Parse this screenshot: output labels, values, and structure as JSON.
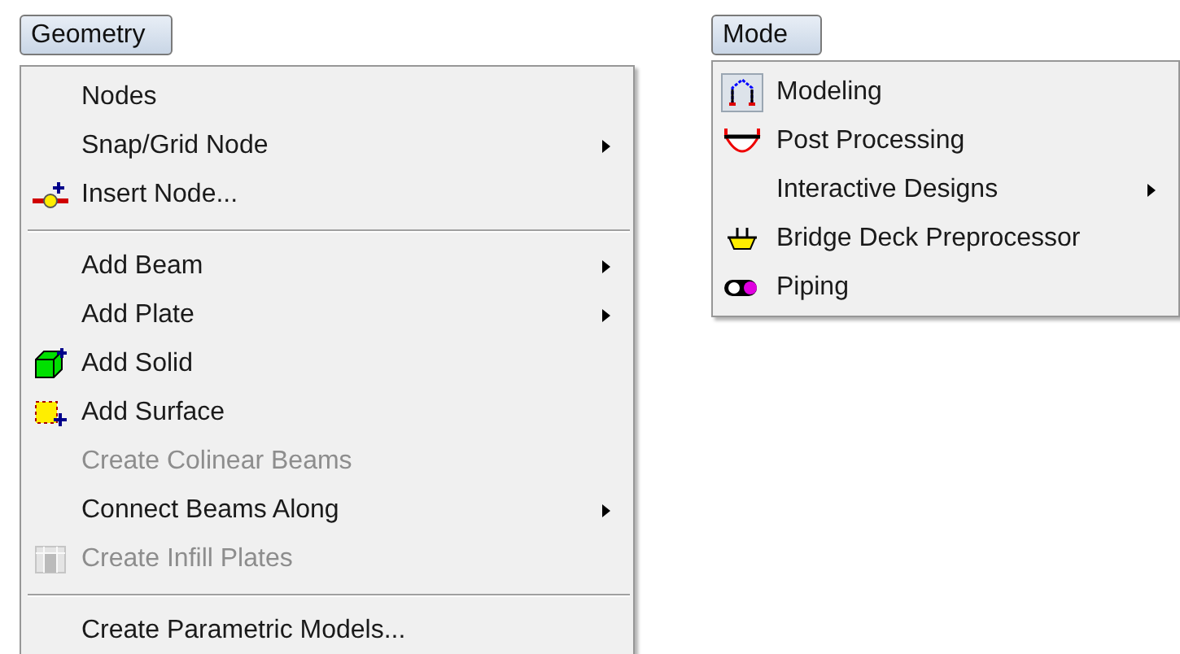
{
  "menus": [
    {
      "title": "Geometry",
      "items": [
        {
          "kind": "item",
          "label": "Nodes",
          "disabled": false,
          "submenu": false
        },
        {
          "kind": "item",
          "label": "Snap/Grid Node",
          "disabled": false,
          "submenu": true
        },
        {
          "kind": "insert-node",
          "label": "Insert Node...",
          "disabled": false,
          "submenu": false
        },
        {
          "kind": "separator"
        },
        {
          "kind": "item",
          "label": "Add Beam",
          "disabled": false,
          "submenu": true
        },
        {
          "kind": "item",
          "label": "Add Plate",
          "disabled": false,
          "submenu": true
        },
        {
          "kind": "solid",
          "label": "Add Solid",
          "disabled": false,
          "submenu": false
        },
        {
          "kind": "surface",
          "label": "Add Surface",
          "disabled": false,
          "submenu": false
        },
        {
          "kind": "item",
          "label": "Create Colinear Beams",
          "disabled": true,
          "submenu": false
        },
        {
          "kind": "item",
          "label": "Connect Beams Along",
          "disabled": false,
          "submenu": true
        },
        {
          "kind": "grid",
          "label": "Create Infill Plates",
          "disabled": true,
          "submenu": false
        },
        {
          "kind": "separator"
        },
        {
          "kind": "item",
          "label": "Create Parametric Models...",
          "disabled": false,
          "submenu": false
        }
      ]
    },
    {
      "title": "Mode",
      "items": [
        {
          "kind": "frame",
          "label": "Modeling",
          "checked": true,
          "disabled": false,
          "submenu": false
        },
        {
          "kind": "diagram",
          "label": "Post Processing",
          "checked": false,
          "disabled": false,
          "submenu": false
        },
        {
          "kind": "item",
          "label": "Interactive Designs",
          "checked": false,
          "disabled": false,
          "submenu": true
        },
        {
          "kind": "deck",
          "label": "Bridge Deck Preprocessor",
          "checked": false,
          "disabled": false,
          "submenu": false
        },
        {
          "kind": "pipe",
          "label": "Piping",
          "checked": false,
          "disabled": false,
          "submenu": false
        }
      ]
    }
  ]
}
